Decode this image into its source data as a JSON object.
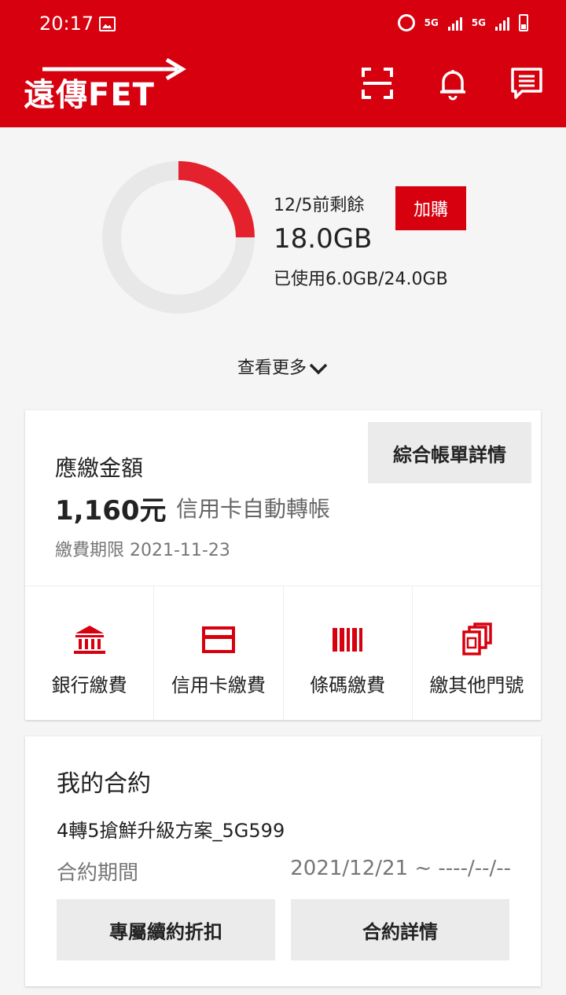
{
  "status_bar": {
    "time": "20:17",
    "network_1": "5G",
    "network_2": "5G"
  },
  "header": {
    "logo_text": "遠傳FET",
    "icons": [
      "scan-icon",
      "bell-icon",
      "message-icon"
    ]
  },
  "data_usage": {
    "label": "12/5前剩餘",
    "remaining": "18.0GB",
    "used_text": "已使用6.0GB/24.0GB",
    "used_fraction": 0.25,
    "buy_button": "加購",
    "see_more": "查看更多",
    "colors": {
      "used": "#e4222e",
      "remaining": "#e8e8e8",
      "brand": "#d7000f"
    }
  },
  "bill": {
    "title": "應繳金額",
    "amount": "1,160元",
    "method": "信用卡自動轉帳",
    "due": "繳費期限 2021-11-23",
    "detail_button": "綜合帳單詳情",
    "payment_options": [
      {
        "label": "銀行繳費",
        "icon": "bank-icon"
      },
      {
        "label": "信用卡繳費",
        "icon": "credit-card-icon"
      },
      {
        "label": "條碼繳費",
        "icon": "barcode-icon"
      },
      {
        "label": "繳其他門號",
        "icon": "multi-phone-icon"
      }
    ]
  },
  "contract": {
    "title": "我的合約",
    "plan": "4轉5搶鮮升級方案_5G599",
    "period_label": "合約期間",
    "period_value": "2021/12/21 ~ ----/--/--",
    "renew_button": "專屬續約折扣",
    "detail_button": "合約詳情"
  }
}
